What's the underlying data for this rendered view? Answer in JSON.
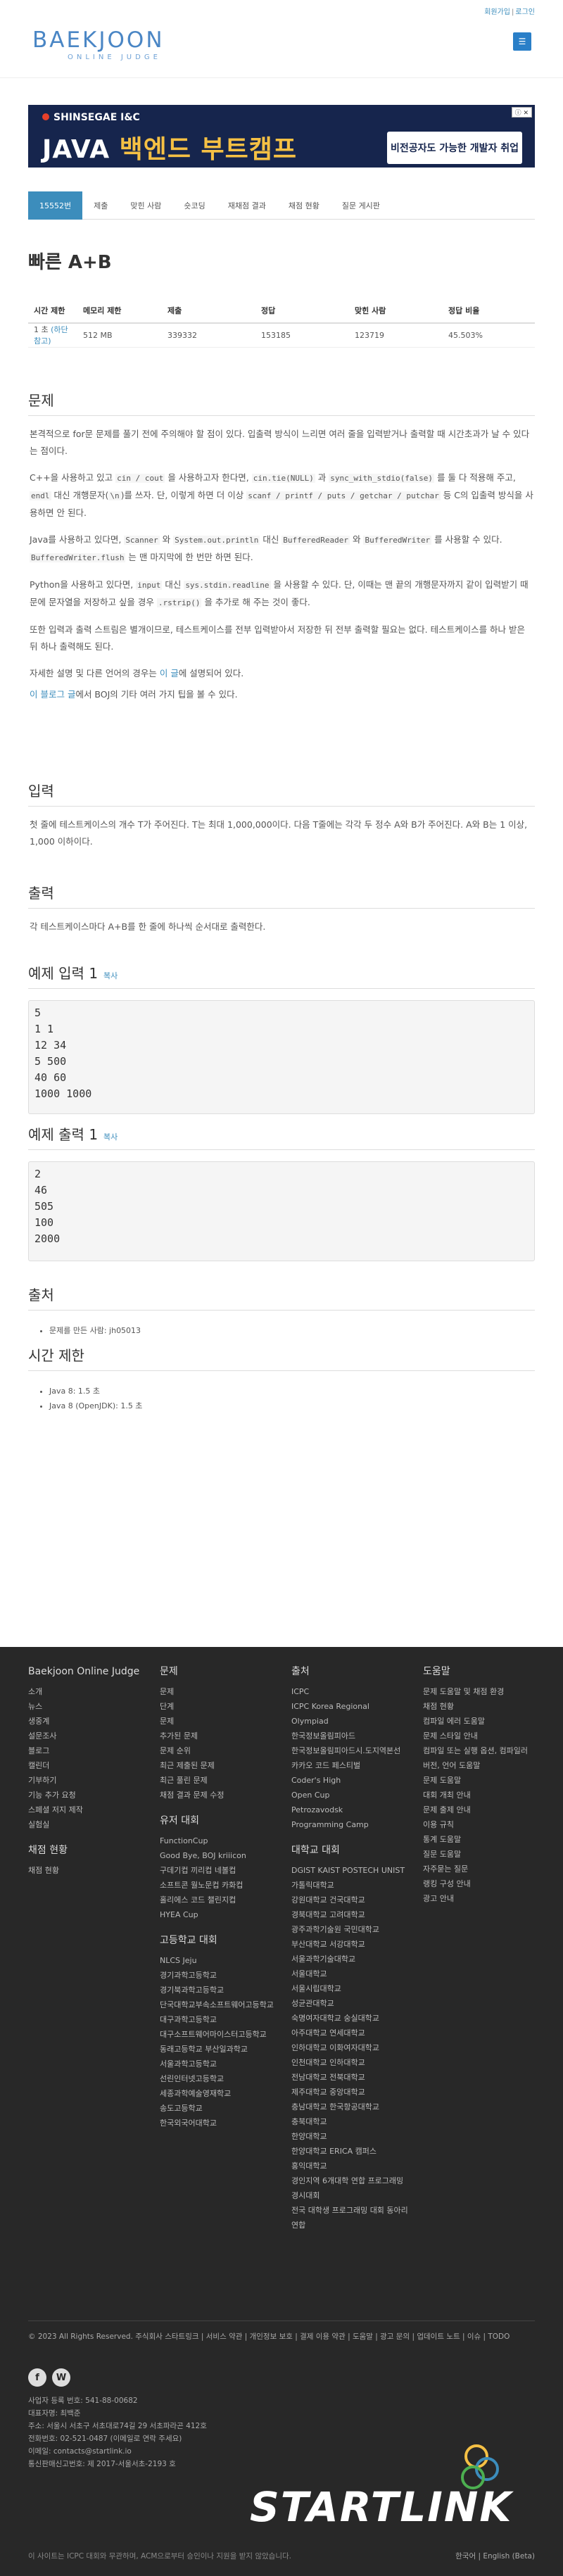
{
  "header": {
    "top_links": [
      "회원가입",
      "로그인"
    ],
    "logo_big": "BAEKJOON",
    "logo_small": "ONLINE JUDGE",
    "menu_icon": "bars-icon"
  },
  "banner": {
    "brand": "SHINSEGAE I&C",
    "main_prefix": "JAVA ",
    "main_highlight": "백엔드 부트캠프",
    "cta": "비전공자도 가능한 개발자 취업",
    "close": "ⓘ ✕"
  },
  "tabs": [
    "15552번",
    "제출",
    "맞힌 사람",
    "숏코딩",
    "재채점 결과",
    "채점 현황",
    "질문 게시판"
  ],
  "problem": {
    "title": "빠른 A+B",
    "table_headers": [
      "시간 제한",
      "메모리 제한",
      "제출",
      "정답",
      "맞힌 사람",
      "정답 비율"
    ],
    "table_values": [
      "1 초 ",
      "512 MB",
      "339332",
      "153185",
      "123719",
      "45.503%"
    ],
    "extra_time": "(하단 참고)"
  },
  "sections": {
    "desc": "문제",
    "input": "입력",
    "output": "출력",
    "sample_in": "예제 입력 1",
    "sample_out": "예제 출력 1",
    "copy": "복사",
    "source": "출처",
    "limit": "시간 제한"
  },
  "desc": {
    "p1": "본격적으로 for문 문제를 풀기 전에 주의해야 할 점이 있다. 입출력 방식이 느리면 여러 줄을 입력받거나 출력할 때 시간초과가 날 수 있다는 점이다.",
    "p2a": "C++을 사용하고 있고 ",
    "p2b": "cin / cout",
    "p2c": " 을 사용하고자 한다면, ",
    "p2d": "cin.tie(NULL)",
    "p2e": " 과 ",
    "p2f": "sync_with_stdio(false)",
    "p2g": " 를 둘 다 적용해 주고, ",
    "p2h": "endl",
    "p2i": " 대신 개행문자(",
    "p2j": "\\n",
    "p2k": ")를 쓰자. 단, 이렇게 하면 더 이상 ",
    "p2l": "scanf / printf / puts / getchar / putchar",
    "p2m": " 등 C의 입출력 방식을 사용하면 안 된다.",
    "p3a": "Java를 사용하고 있다면, ",
    "p3b": "Scanner",
    "p3c": " 와 ",
    "p3d": "System.out.println",
    "p3e": " 대신 ",
    "p3f": "BufferedReader",
    "p3g": " 와 ",
    "p3h": "BufferedWriter",
    "p3i": " 를 사용할 수 있다. ",
    "p3j": "BufferedWriter.flush",
    "p3k": " 는 맨 마지막에 한 번만 하면 된다.",
    "p4a": "Python을 사용하고 있다면, ",
    "p4b": "input",
    "p4c": " 대신 ",
    "p4d": "sys.stdin.readline",
    "p4e": " 을 사용할 수 있다. 단, 이때는 맨 끝의 개행문자까지 같이 입력받기 때문에 문자열을 저장하고 싶을 경우 ",
    "p4f": ".rstrip()",
    "p4g": " 을 추가로 해 주는 것이 좋다.",
    "p5": "또한 입력과 출력 스트림은 별개이므로, 테스트케이스를 전부 입력받아서 저장한 뒤 전부 출력할 필요는 없다. 테스트케이스를 하나 받은 뒤 하나 출력해도 된다.",
    "p6a": "자세한 설명 및 다른 언어의 경우는 ",
    "p6b": "이 글",
    "p6c": "에 설명되어 있다.",
    "p7a": "이 블로그 글",
    "p7b": "에서 BOJ의 기타 여러 가지 팁을 볼 수 있다."
  },
  "input_text": "첫 줄에 테스트케이스의 개수 T가 주어진다. T는 최대 1,000,000이다. 다음 T줄에는 각각 두 정수 A와 B가 주어진다. A와 B는 1 이상, 1,000 이하이다.",
  "output_text": "각 테스트케이스마다 A+B를 한 줄에 하나씩 순서대로 출력한다.",
  "sample_input": "5\n1 1\n12 34\n5 500\n40 60\n1000 1000",
  "sample_output": "2\n46\n505\n100\n2000",
  "source_items": [
    "문제를 만든 사람: jh05013"
  ],
  "limit_items": [
    "Java 8: 1.5 초",
    "Java 8 (OpenJDK): 1.5 초"
  ],
  "footer": {
    "col1": {
      "title": "Baekjoon Online Judge",
      "items": [
        "소개",
        "뉴스",
        "생중계",
        "설문조사",
        "블로그",
        "캘린더",
        "기부하기",
        "기능 추가 요청",
        "스페셜 저지 제작",
        "실험실"
      ],
      "title2": "채점 현황",
      "items2": [
        "채점 현황"
      ]
    },
    "col2": {
      "title": "문제",
      "items": [
        "문제",
        "단계",
        "문제",
        "추가된 문제",
        "문제 순위",
        "최근 제출된 문제",
        "최근 풀린 문제",
        "채점 결과 문제 수정"
      ],
      "title2": "유저 대회",
      "items2": [
        "FunctionCup",
        "Good Bye, BOJ kriiicon",
        "구데기컵 끼리컵 네볼컵",
        "소프트콘 월노문컵 카화컵",
        "홀리에스 코드 챌린지컵",
        "HYEA Cup"
      ],
      "title3": "고등학교 대회",
      "items3": [
        "NLCS Jeju",
        "경기과학고등학교",
        "경기북과학고등학교",
        "단국대학교부속소프트웨어고등학교",
        "대구과학고등학교",
        "대구소프트웨어마이스터고등학교",
        "동래고등학교 부산일과학교",
        "서울과학고등학교",
        "선린인터넷고등학교",
        "세종과학예술영재학교",
        "송도고등학교",
        "한국외국어대학교"
      ]
    },
    "col3": {
      "title": "출처",
      "items": [
        "ICPC",
        "ICPC Korea Regional",
        "Olympiad",
        "한국정보올림피아드",
        "한국정보올림피아드시.도지역본선",
        "카카오 코드 페스티벌",
        "Coder's High",
        "Open Cup",
        "Petrozavodsk",
        "Programming Camp"
      ],
      "title2": "대학교 대회",
      "items2": [
        "DGIST KAIST POSTECH UNIST 가톨릭대학교",
        "강원대학교 건국대학교",
        "경북대학교 고려대학교",
        "광주과학기술원 국민대학교",
        "부산대학교 서강대학교",
        "서울과학기술대학교",
        "서울대학교",
        "서울시립대학교",
        "성균관대학교",
        "숙명여자대학교 숭실대학교",
        "아주대학교 연세대학교",
        "인하대학교 이화여자대학교",
        "인천대학교 인하대학교",
        "전남대학교 전북대학교",
        "제주대학교 중앙대학교",
        "충남대학교 한국항공대학교",
        "충북대학교",
        "한양대학교",
        "한양대학교 ERICA 캠퍼스",
        "홍익대학교",
        "경인지역 6개대학 연합 프로그래밍 경시대회",
        "전국 대학생 프로그래밍 대회 동아리 연합"
      ]
    },
    "col4": {
      "title": "도움말",
      "items": [
        "문제 도움말 및 채점 환경",
        "채점 현황",
        "컴파일 에러 도움말",
        "문제 스타일 안내",
        "컴파일 또는 실행 옵션, 컴파일러 버전, 언어 도움말",
        "문제 도움말",
        "대회 개최 안내",
        "문제 출제 안내",
        "이용 규칙",
        "통계 도움말",
        "질문 도움말",
        "자주묻는 질문",
        "랭킹 구성 안내",
        "광고 안내"
      ]
    },
    "bottom_links": "© 2023 All Rights Reserved. 주식회사 스타트링크 | 서비스 약관 | 개인정보 보호 | 결제 이용 약관 | 도움말 | 광고 문의 | 업데이트 노트 | 이슈 | TODO",
    "company": [
      "사업자 등록 번호: 541-88-00682",
      "대표자명: 최백준",
      "주소: 서울시 서초구 서초대로74길 29 서초파라곤 412호",
      "전화번호: 02-521-0487 (이메일로 연락 주세요)",
      "이메일: contacts@startlink.io",
      "통신판매신고번호: 제 2017-서울서초-2193 호"
    ],
    "note": "이 사이트는 ICPC 대회와 무관하며, ACM으로부터 승인이나 지원을 받지 않았습니다.",
    "lang": "한국어 | English (Beta)",
    "startlink": "STARTLINK",
    "social": [
      "f",
      "W"
    ]
  }
}
